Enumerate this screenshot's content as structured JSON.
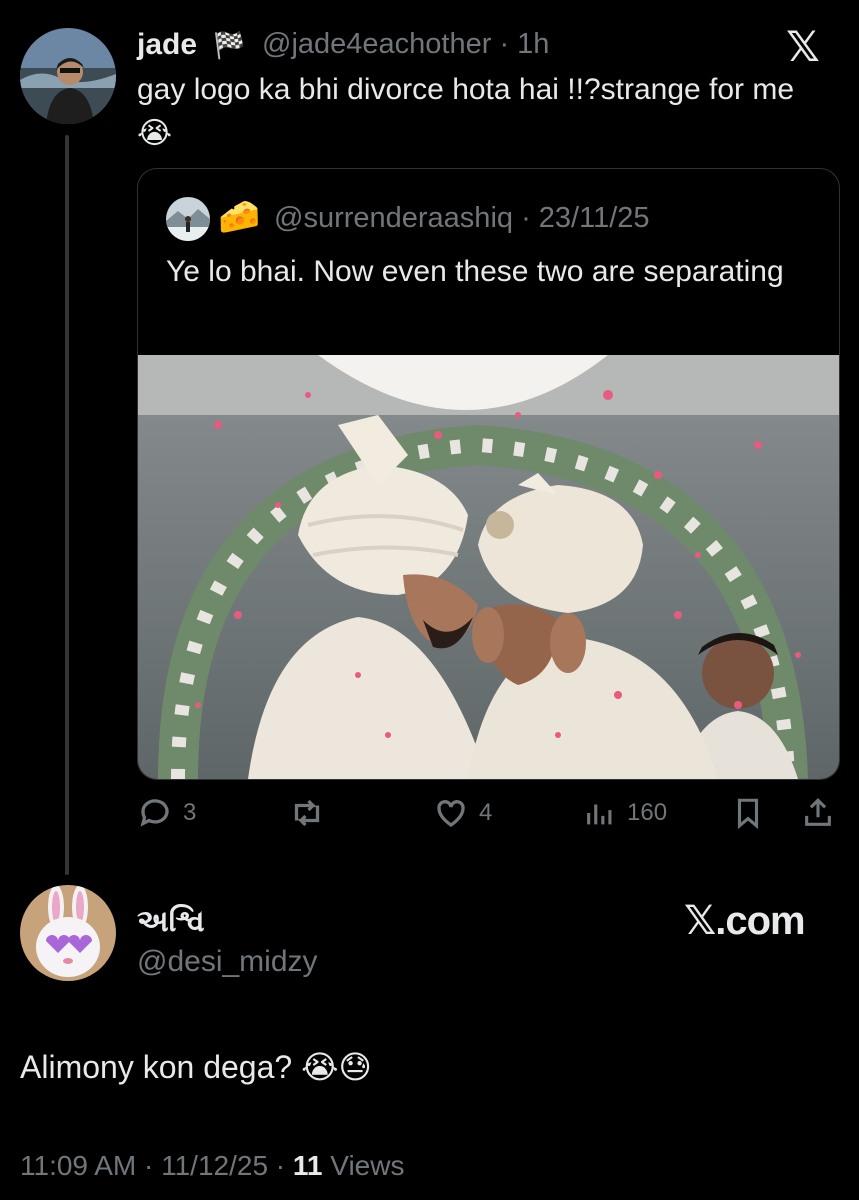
{
  "tweet": {
    "author_name": "jade",
    "flag_emoji": "🏁",
    "handle_time": "@jade4eachother · 1h",
    "text": "gay logo ka bhi divorce hota hai !!?strange for me 😭",
    "platform_logo": "𝕏"
  },
  "quote": {
    "emoji": "🧀",
    "handle_date": "@surrenderaashiq · 23/11/25",
    "text": "Ye lo bhai. Now even these two are separating"
  },
  "actions": {
    "replies": "3",
    "likes": "4",
    "views": "160",
    "icons": [
      "reply-icon",
      "retweet-icon",
      "like-icon",
      "views-icon",
      "bookmark-icon",
      "share-icon"
    ]
  },
  "reply": {
    "author_name": "અશ્વિ",
    "handle": "@desi_midzy",
    "watermark": "𝕏.com",
    "text": "Alimony kon dega? 😭😓",
    "timestamp": "11:09 AM · 11/12/25 · ",
    "views_count": "11",
    "views_label": " Views"
  }
}
